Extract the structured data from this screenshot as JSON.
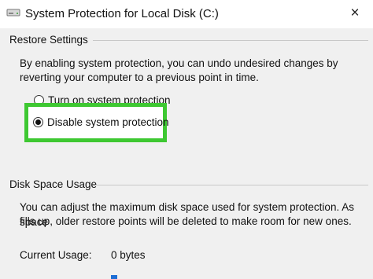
{
  "window": {
    "title": "System Protection for Local Disk (C:)",
    "close_glyph": "×",
    "icon": "drive-icon"
  },
  "restore_settings": {
    "header": "Restore Settings",
    "description_line1": "By enabling system protection, you can undo undesired changes by",
    "description_line2": "reverting your computer to a previous point in time.",
    "options": [
      {
        "label": "Turn on system protection",
        "selected": false
      },
      {
        "label": "Disable system protection",
        "selected": true
      }
    ],
    "highlight_color": "#3ec832"
  },
  "disk_space_usage": {
    "header": "Disk Space Usage",
    "description_line1": "You can adjust the maximum disk space used for system protection. As space",
    "description_line2": "fills up, older restore points will be deleted to make room for new ones.",
    "current_usage_label": "Current Usage:",
    "current_usage_value": "0 bytes"
  }
}
